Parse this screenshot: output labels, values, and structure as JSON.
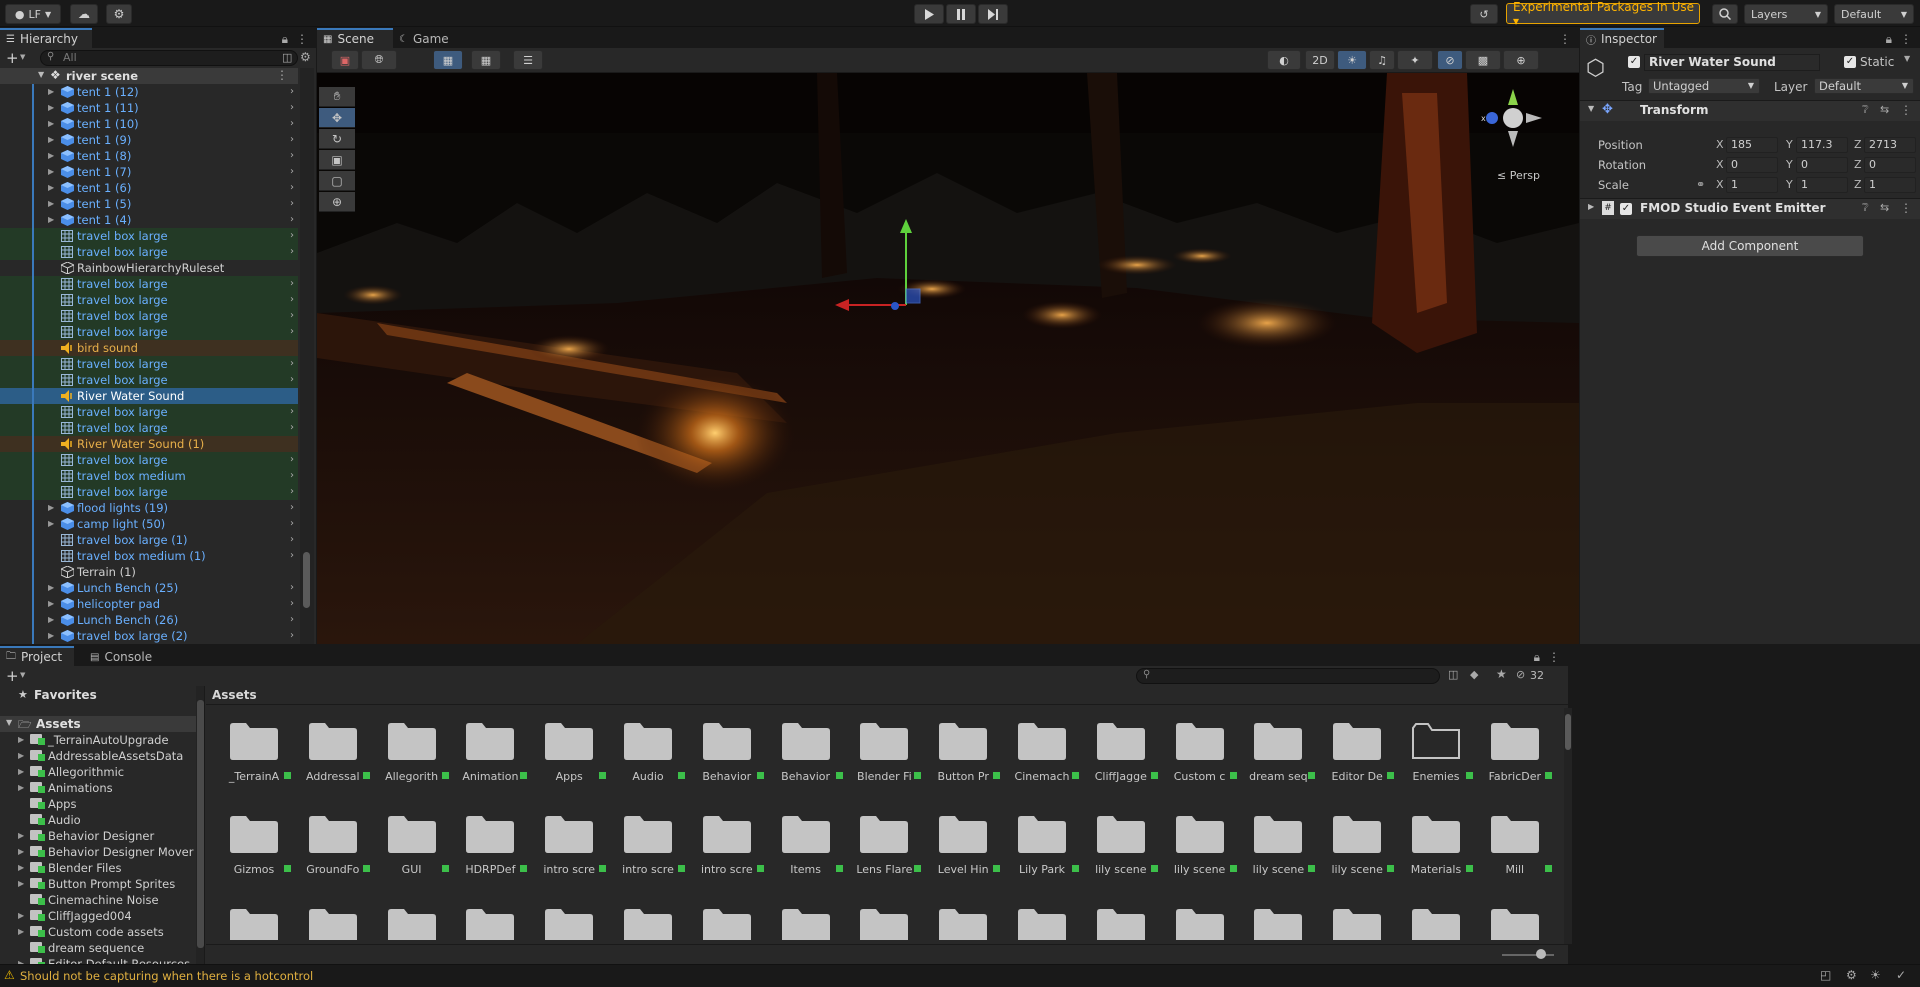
{
  "topbar": {
    "account_label": "LF",
    "experimental_label": "Experimental Packages In Use ▾",
    "layers_label": "Layers",
    "layout_label": "Default"
  },
  "hierarchy": {
    "tab_label": "Hierarchy",
    "search_placeholder": "All",
    "scene_name": "river scene",
    "items": [
      {
        "label": "tent 1 (12)",
        "type": "prefab",
        "expand": true,
        "color": "#6ab0ff"
      },
      {
        "label": "tent 1 (11)",
        "type": "prefab",
        "expand": true,
        "color": "#6ab0ff"
      },
      {
        "label": "tent 1 (10)",
        "type": "prefab",
        "expand": true,
        "color": "#6ab0ff"
      },
      {
        "label": "tent 1 (9)",
        "type": "prefab",
        "expand": true,
        "color": "#6ab0ff"
      },
      {
        "label": "tent 1 (8)",
        "type": "prefab",
        "expand": true,
        "color": "#6ab0ff"
      },
      {
        "label": "tent 1 (7)",
        "type": "prefab",
        "expand": true,
        "color": "#6ab0ff"
      },
      {
        "label": "tent 1 (6)",
        "type": "prefab",
        "expand": true,
        "color": "#6ab0ff"
      },
      {
        "label": "tent 1 (5)",
        "type": "prefab",
        "expand": true,
        "color": "#6ab0ff"
      },
      {
        "label": "tent 1 (4)",
        "type": "prefab",
        "expand": true,
        "color": "#6ab0ff"
      },
      {
        "label": "travel box large",
        "type": "box",
        "expand": false,
        "color": "#6ab0ff",
        "bg": "#233a26"
      },
      {
        "label": "travel box large",
        "type": "box",
        "expand": false,
        "color": "#6ab0ff",
        "bg": "#233a26"
      },
      {
        "label": "RainbowHierarchyRuleset",
        "type": "object",
        "expand": false,
        "color": "#d0d0d0"
      },
      {
        "label": "travel box large",
        "type": "box",
        "expand": false,
        "color": "#6ab0ff",
        "bg": "#233a26"
      },
      {
        "label": "travel box large",
        "type": "box",
        "expand": false,
        "color": "#6ab0ff",
        "bg": "#233a26"
      },
      {
        "label": "travel box large",
        "type": "box",
        "expand": false,
        "color": "#6ab0ff",
        "bg": "#233a26"
      },
      {
        "label": "travel box large",
        "type": "box",
        "expand": false,
        "color": "#6ab0ff",
        "bg": "#233a26"
      },
      {
        "label": "bird sound",
        "type": "sound",
        "expand": false,
        "color": "#e8b04a",
        "bg": "#3e3020"
      },
      {
        "label": "travel box large",
        "type": "box",
        "expand": false,
        "color": "#6ab0ff",
        "bg": "#233a26"
      },
      {
        "label": "travel box large",
        "type": "box",
        "expand": false,
        "color": "#6ab0ff",
        "bg": "#233a26"
      },
      {
        "label": "River Water Sound",
        "type": "sound",
        "expand": false,
        "color": "#ffffff",
        "bg": "#2c5d87",
        "selected": true
      },
      {
        "label": "travel box large",
        "type": "box",
        "expand": false,
        "color": "#6ab0ff",
        "bg": "#233a26"
      },
      {
        "label": "travel box large",
        "type": "box",
        "expand": false,
        "color": "#6ab0ff",
        "bg": "#233a26"
      },
      {
        "label": "River Water Sound (1)",
        "type": "sound",
        "expand": false,
        "color": "#e8b04a",
        "bg": "#3e3020"
      },
      {
        "label": "travel box large",
        "type": "box",
        "expand": false,
        "color": "#6ab0ff",
        "bg": "#233a26"
      },
      {
        "label": "travel box medium",
        "type": "box",
        "expand": false,
        "color": "#6ab0ff",
        "bg": "#233a26"
      },
      {
        "label": "travel box large",
        "type": "box",
        "expand": false,
        "color": "#6ab0ff",
        "bg": "#233a26"
      },
      {
        "label": "flood lights (19)",
        "type": "prefab",
        "expand": true,
        "color": "#6ab0ff"
      },
      {
        "label": "camp light (50)",
        "type": "prefab",
        "expand": true,
        "color": "#6ab0ff"
      },
      {
        "label": "travel box large (1)",
        "type": "box",
        "expand": false,
        "color": "#6ab0ff"
      },
      {
        "label": "travel box medium (1)",
        "type": "box",
        "expand": false,
        "color": "#6ab0ff"
      },
      {
        "label": "Terrain (1)",
        "type": "object",
        "expand": false,
        "color": "#d0d0d0"
      },
      {
        "label": "Lunch Bench (25)",
        "type": "prefab",
        "expand": true,
        "color": "#6ab0ff"
      },
      {
        "label": "helicopter pad",
        "type": "prefab",
        "expand": true,
        "color": "#6ab0ff"
      },
      {
        "label": "Lunch Bench (26)",
        "type": "prefab",
        "expand": true,
        "color": "#6ab0ff"
      },
      {
        "label": "travel box large (2)",
        "type": "prefab",
        "expand": true,
        "color": "#6ab0ff"
      }
    ]
  },
  "scene": {
    "tabs": [
      {
        "label": "Scene"
      },
      {
        "label": "Game"
      }
    ],
    "btn_2d": "2D",
    "persp_label": "≤ Persp"
  },
  "inspector": {
    "tab_label": "Inspector",
    "object_name": "River Water Sound",
    "static_label": "Static",
    "tag_label": "Tag",
    "tag_value": "Untagged",
    "layer_label": "Layer",
    "layer_value": "Default",
    "transform_title": "Transform",
    "rows": [
      {
        "label": "Position",
        "x": "185",
        "y": "117.3",
        "z": "2713"
      },
      {
        "label": "Rotation",
        "x": "0",
        "y": "0",
        "z": "0"
      },
      {
        "label": "Scale",
        "x": "1",
        "y": "1",
        "z": "1"
      }
    ],
    "axis_x": "X",
    "axis_y": "Y",
    "axis_z": "Z",
    "component_title": "FMOD Studio Event Emitter",
    "add_component_label": "Add Component"
  },
  "project": {
    "tabs": [
      {
        "label": "Project"
      },
      {
        "label": "Console"
      }
    ],
    "favorites_label": "Favorites",
    "assets_label": "Assets",
    "breadcrumb": "Assets",
    "hidden_count": "32",
    "tree": [
      "_TerrainAutoUpgrade",
      "AddressableAssetsData",
      "Allegorithmic",
      "Animations",
      "Apps",
      "Audio",
      "Behavior Designer",
      "Behavior Designer Mover",
      "Blender Files",
      "Button Prompt Sprites",
      "Cinemachine Noise",
      "CliffJagged004",
      "Custom code assets",
      "dream sequence",
      "Editor Default Resources"
    ],
    "grid_row1": [
      "_TerrainA",
      "Addressal",
      "Allegorith",
      "Animation",
      "Apps",
      "Audio",
      "Behavior",
      "Behavior",
      "Blender Fi",
      "Button Pr",
      "Cinemach",
      "CliffJagge",
      "Custom c",
      "dream seq",
      "Editor De",
      "Enemies",
      "FabricDer"
    ],
    "grid_row2": [
      "Gizmos",
      "GroundFo",
      "GUI",
      "HDRPDef",
      "intro scre",
      "intro scre",
      "intro scre",
      "Items",
      "Lens Flare",
      "Level Hin",
      "Lily Park",
      "lily scene",
      "lily scene",
      "lily scene",
      "lily scene",
      "Materials",
      "Mill"
    ]
  },
  "status": {
    "message": "Should not be capturing when there is a hotcontrol"
  }
}
